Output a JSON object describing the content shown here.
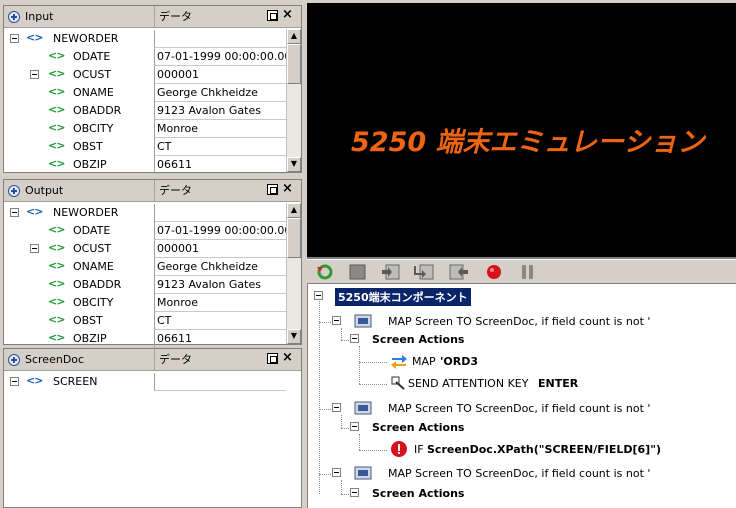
{
  "input_panel": {
    "title": "Input",
    "column_header": "データ",
    "rows": [
      {
        "label": "NEWORDER",
        "value": ""
      },
      {
        "label": "ODATE",
        "value": "07-01-1999 00:00:00.00"
      },
      {
        "label": "OCUST",
        "value": "000001"
      },
      {
        "label": "ONAME",
        "value": "George Chkheidze"
      },
      {
        "label": "OBADDR",
        "value": "9123 Avalon Gates"
      },
      {
        "label": "OBCITY",
        "value": "Monroe"
      },
      {
        "label": "OBST",
        "value": "CT"
      },
      {
        "label": "OBZIP",
        "value": "06611"
      }
    ]
  },
  "output_panel": {
    "title": "Output",
    "column_header": "データ",
    "rows": [
      {
        "label": "NEWORDER",
        "value": ""
      },
      {
        "label": "ODATE",
        "value": "07-01-1999 00:00:00.00"
      },
      {
        "label": "OCUST",
        "value": "000001"
      },
      {
        "label": "ONAME",
        "value": "George Chkheidze"
      },
      {
        "label": "OBADDR",
        "value": "9123 Avalon Gates"
      },
      {
        "label": "OBCITY",
        "value": "Monroe"
      },
      {
        "label": "OBST",
        "value": "CT"
      },
      {
        "label": "OBZIP",
        "value": "06611"
      }
    ]
  },
  "screendoc_panel": {
    "title": "ScreenDoc",
    "column_header": "データ",
    "rows": [
      {
        "label": "SCREEN",
        "value": ""
      }
    ]
  },
  "emulator": {
    "text": "5250 端末エミュレーション",
    "text_color": "#ee6412",
    "background": "#000000"
  },
  "toolbar": {
    "icons": [
      "refresh-icon",
      "stop-icon",
      "step-icon",
      "step-into-icon",
      "step-over-icon",
      "record-icon",
      "pause-icon"
    ]
  },
  "actions": {
    "root_label": "5250端末コンポーネント",
    "map1": "MAP Screen TO ScreenDoc, if field count is not '",
    "screen_actions_1": "Screen Actions",
    "map_ord3_prefix": "MAP ",
    "map_ord3_value": "'ORD3",
    "send_prefix": "SEND ATTENTION KEY ",
    "send_key": "ENTER",
    "map2": "MAP Screen TO ScreenDoc, if field count is not '",
    "screen_actions_2": "Screen Actions",
    "if_prefix": "IF ",
    "if_expr": "ScreenDoc.XPath(\"SCREEN/FIELD[6]\")",
    "map3": "MAP Screen TO ScreenDoc, if field count is not '",
    "screen_actions_3": "Screen Actions"
  }
}
